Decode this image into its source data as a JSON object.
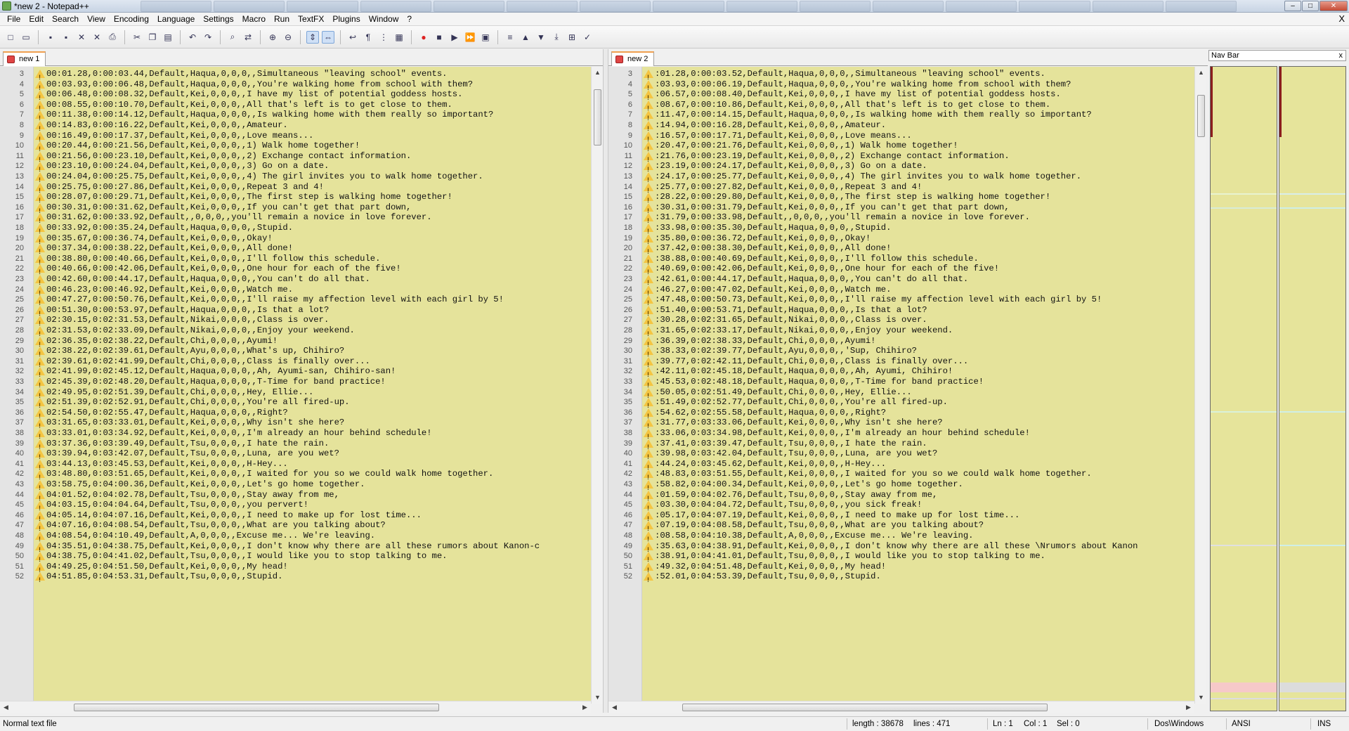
{
  "window": {
    "title": "*new  2 - Notepad++"
  },
  "menu": [
    "File",
    "Edit",
    "Search",
    "View",
    "Encoding",
    "Language",
    "Settings",
    "Macro",
    "Run",
    "TextFX",
    "Plugins",
    "Window",
    "?"
  ],
  "menu_close": "X",
  "toolbar_icons": [
    "new-file-icon",
    "open-icon",
    "save-icon",
    "save-all-icon",
    "close-icon",
    "close-all-icon",
    "print-icon",
    "cut-icon",
    "copy-icon",
    "paste-icon",
    "undo-icon",
    "redo-icon",
    "find-icon",
    "replace-icon",
    "zoom-in-icon",
    "zoom-out-icon",
    "sync-v-icon",
    "sync-h-icon",
    "wrap-icon",
    "all-chars-icon",
    "indent-guide-icon",
    "doc-map-icon",
    "record-icon",
    "stop-icon",
    "play-icon",
    "play-multi-icon",
    "save-macro-icon",
    "compare-icon",
    "prev-diff-icon",
    "next-diff-icon",
    "last-diff-icon",
    "nav-icon",
    "spellcheck-icon"
  ],
  "left": {
    "tab": "new  1",
    "lines": [
      {
        "n": "3",
        "t": "00:01.28,0:00:03.44,Default,Haqua,0,0,0,,Simultaneous \"leaving school\" events."
      },
      {
        "n": "4",
        "t": "00:03.93,0:00:06.48,Default,Haqua,0,0,0,,You're walking home from school with them?"
      },
      {
        "n": "5",
        "t": "00:06.48,0:00:08.32,Default,Kei,0,0,0,,I have my list of potential goddess hosts."
      },
      {
        "n": "6",
        "t": "00:08.55,0:00:10.70,Default,Kei,0,0,0,,All that's left is to get close to them."
      },
      {
        "n": "7",
        "t": "00:11.38,0:00:14.12,Default,Haqua,0,0,0,,Is walking home with them really so important?"
      },
      {
        "n": "8",
        "t": "00:14.83,0:00:16.22,Default,Kei,0,0,0,,Amateur."
      },
      {
        "n": "9",
        "t": "00:16.49,0:00:17.37,Default,Kei,0,0,0,,Love means..."
      },
      {
        "n": "10",
        "t": "00:20.44,0:00:21.56,Default,Kei,0,0,0,,1) Walk home together!"
      },
      {
        "n": "11",
        "t": "00:21.56,0:00:23.10,Default,Kei,0,0,0,,2) Exchange contact information."
      },
      {
        "n": "12",
        "t": "00:23.10,0:00:24.04,Default,Kei,0,0,0,,3) Go on a date."
      },
      {
        "n": "13",
        "t": "00:24.04,0:00:25.75,Default,Kei,0,0,0,,4) The girl invites you to walk home together."
      },
      {
        "n": "14",
        "t": "00:25.75,0:00:27.86,Default,Kei,0,0,0,,Repeat 3 and 4!"
      },
      {
        "n": "15",
        "t": "00:28.07,0:00:29.71,Default,Kei,0,0,0,,The first step is walking home together!"
      },
      {
        "n": "16",
        "t": "00:30.31,0:00:31.62,Default,Kei,0,0,0,,If you can't get that part down,"
      },
      {
        "n": "17",
        "t": "00:31.62,0:00:33.92,Default,,0,0,0,,you'll remain a novice in love forever."
      },
      {
        "n": "18",
        "t": "00:33.92,0:00:35.24,Default,Haqua,0,0,0,,Stupid."
      },
      {
        "n": "19",
        "t": "00:35.67,0:00:36.74,Default,Kei,0,0,0,,Okay!"
      },
      {
        "n": "20",
        "t": "00:37.34,0:00:38.22,Default,Kei,0,0,0,,All done!"
      },
      {
        "n": "21",
        "t": "00:38.80,0:00:40.66,Default,Kei,0,0,0,,I'll follow this schedule."
      },
      {
        "n": "22",
        "t": "00:40.66,0:00:42.06,Default,Kei,0,0,0,,One hour for each of the five!"
      },
      {
        "n": "23",
        "t": "00:42.60,0:00:44.17,Default,Haqua,0,0,0,,You can't do all that."
      },
      {
        "n": "24",
        "t": "00:46.23,0:00:46.92,Default,Kei,0,0,0,,Watch me."
      },
      {
        "n": "25",
        "t": "00:47.27,0:00:50.76,Default,Kei,0,0,0,,I'll raise my affection level with each girl by 5!"
      },
      {
        "n": "26",
        "t": "00:51.30,0:00:53.97,Default,Haqua,0,0,0,,Is that a lot?"
      },
      {
        "n": "27",
        "t": "02:30.15,0:02:31.53,Default,Nikai,0,0,0,,Class is over."
      },
      {
        "n": "28",
        "t": "02:31.53,0:02:33.09,Default,Nikai,0,0,0,,Enjoy your weekend."
      },
      {
        "n": "29",
        "t": "02:36.35,0:02:38.22,Default,Chi,0,0,0,,Ayumi!"
      },
      {
        "n": "30",
        "t": "02:38.22,0:02:39.61,Default,Ayu,0,0,0,,What's up, Chihiro?"
      },
      {
        "n": "31",
        "t": "02:39.61,0:02:41.99,Default,Chi,0,0,0,,Class is finally over..."
      },
      {
        "n": "32",
        "t": "02:41.99,0:02:45.12,Default,Haqua,0,0,0,,Ah, Ayumi-san, Chihiro-san!"
      },
      {
        "n": "33",
        "t": "02:45.39,0:02:48.20,Default,Haqua,0,0,0,,T-Time for band practice!"
      },
      {
        "n": "34",
        "t": "02:49.95,0:02:51.39,Default,Chi,0,0,0,,Hey, Ellie..."
      },
      {
        "n": "35",
        "t": "02:51.39,0:02:52.91,Default,Chi,0,0,0,,You're all fired-up."
      },
      {
        "n": "36",
        "t": "02:54.50,0:02:55.47,Default,Haqua,0,0,0,,Right?"
      },
      {
        "n": "37",
        "t": "03:31.65,0:03:33.01,Default,Kei,0,0,0,,Why isn't she here?"
      },
      {
        "n": "38",
        "t": "03:33.01,0:03:34.92,Default,Kei,0,0,0,,I'm already an hour behind schedule!"
      },
      {
        "n": "39",
        "t": "03:37.36,0:03:39.49,Default,Tsu,0,0,0,,I hate the rain."
      },
      {
        "n": "40",
        "t": "03:39.94,0:03:42.07,Default,Tsu,0,0,0,,Luna, are you wet?"
      },
      {
        "n": "41",
        "t": "03:44.13,0:03:45.53,Default,Kei,0,0,0,,H-Hey..."
      },
      {
        "n": "42",
        "t": "03:48.80,0:03:51.65,Default,Kei,0,0,0,,I waited for you so we could walk home together."
      },
      {
        "n": "43",
        "t": "03:58.75,0:04:00.36,Default,Kei,0,0,0,,Let's go home together."
      },
      {
        "n": "44",
        "t": "04:01.52,0:04:02.78,Default,Tsu,0,0,0,,Stay away from me,"
      },
      {
        "n": "45",
        "t": "04:03.15,0:04:04.64,Default,Tsu,0,0,0,,you pervert!"
      },
      {
        "n": "46",
        "t": "04:05.14,0:04:07.16,Default,Kei,0,0,0,,I need to make up for lost time..."
      },
      {
        "n": "47",
        "t": "04:07.16,0:04:08.54,Default,Tsu,0,0,0,,What are you talking about?"
      },
      {
        "n": "48",
        "t": "04:08.54,0:04:10.49,Default,A,0,0,0,,Excuse me... We're leaving."
      },
      {
        "n": "49",
        "t": "04:35.51,0:04:38.75,Default,Kei,0,0,0,,I don't know why there are all these rumors about Kanon-c"
      },
      {
        "n": "50",
        "t": "04:38.75,0:04:41.02,Default,Tsu,0,0,0,,I would like you to stop talking to me."
      },
      {
        "n": "51",
        "t": "04:49.25,0:04:51.50,Default,Kei,0,0,0,,My head!"
      },
      {
        "n": "52",
        "t": "04:51.85,0:04:53.31,Default,Tsu,0,0,0,,Stupid."
      }
    ]
  },
  "right": {
    "tab": "new  2",
    "lines": [
      {
        "n": "3",
        "t": ":01.28,0:00:03.52,Default,Haqua,0,0,0,,Simultaneous \"leaving school\" events."
      },
      {
        "n": "4",
        "t": ":03.93,0:00:06.19,Default,Haqua,0,0,0,,You're walking home from school with them?"
      },
      {
        "n": "5",
        "t": ":06.57,0:00:08.40,Default,Kei,0,0,0,,I have my list of potential goddess hosts."
      },
      {
        "n": "6",
        "t": ":08.67,0:00:10.86,Default,Kei,0,0,0,,All that's left is to get close to them."
      },
      {
        "n": "7",
        "t": ":11.47,0:00:14.15,Default,Haqua,0,0,0,,Is walking home with them really so important?"
      },
      {
        "n": "8",
        "t": ":14.94,0:00:16.28,Default,Kei,0,0,0,,Amateur."
      },
      {
        "n": "9",
        "t": ":16.57,0:00:17.71,Default,Kei,0,0,0,,Love means..."
      },
      {
        "n": "10",
        "t": ":20.47,0:00:21.76,Default,Kei,0,0,0,,1) Walk home together!"
      },
      {
        "n": "11",
        "t": ":21.76,0:00:23.19,Default,Kei,0,0,0,,2) Exchange contact information."
      },
      {
        "n": "12",
        "t": ":23.19,0:00:24.17,Default,Kei,0,0,0,,3) Go on a date."
      },
      {
        "n": "13",
        "t": ":24.17,0:00:25.77,Default,Kei,0,0,0,,4) The girl invites you to walk home together."
      },
      {
        "n": "14",
        "t": ":25.77,0:00:27.82,Default,Kei,0,0,0,,Repeat 3 and 4!"
      },
      {
        "n": "15",
        "t": ":28.22,0:00:29.80,Default,Kei,0,0,0,,The first step is walking home together!"
      },
      {
        "n": "16",
        "t": ":30.31,0:00:31.79,Default,Kei,0,0,0,,If you can't get that part down,"
      },
      {
        "n": "17",
        "t": ":31.79,0:00:33.98,Default,,0,0,0,,you'll remain a novice in love forever."
      },
      {
        "n": "18",
        "t": ":33.98,0:00:35.30,Default,Haqua,0,0,0,,Stupid."
      },
      {
        "n": "19",
        "t": ":35.80,0:00:36.72,Default,Kei,0,0,0,,Okay!"
      },
      {
        "n": "20",
        "t": ":37.42,0:00:38.30,Default,Kei,0,0,0,,All done!"
      },
      {
        "n": "21",
        "t": ":38.88,0:00:40.69,Default,Kei,0,0,0,,I'll follow this schedule."
      },
      {
        "n": "22",
        "t": ":40.69,0:00:42.06,Default,Kei,0,0,0,,One hour for each of the five!"
      },
      {
        "n": "23",
        "t": ":42.61,0:00:44.17,Default,Haqua,0,0,0,,You can't do all that."
      },
      {
        "n": "24",
        "t": ":46.27,0:00:47.02,Default,Kei,0,0,0,,Watch me."
      },
      {
        "n": "25",
        "t": ":47.48,0:00:50.73,Default,Kei,0,0,0,,I'll raise my affection level with each girl by 5!"
      },
      {
        "n": "26",
        "t": ":51.40,0:00:53.71,Default,Haqua,0,0,0,,Is that a lot?"
      },
      {
        "n": "27",
        "t": ":30.28,0:02:31.65,Default,Nikai,0,0,0,,Class is over."
      },
      {
        "n": "28",
        "t": ":31.65,0:02:33.17,Default,Nikai,0,0,0,,Enjoy your weekend."
      },
      {
        "n": "29",
        "t": ":36.39,0:02:38.33,Default,Chi,0,0,0,,Ayumi!"
      },
      {
        "n": "30",
        "t": ":38.33,0:02:39.77,Default,Ayu,0,0,0,,'Sup, Chihiro?"
      },
      {
        "n": "31",
        "t": ":39.77,0:02:42.11,Default,Chi,0,0,0,,Class is finally over..."
      },
      {
        "n": "32",
        "t": ":42.11,0:02:45.18,Default,Haqua,0,0,0,,Ah, Ayumi, Chihiro!"
      },
      {
        "n": "33",
        "t": ":45.53,0:02:48.18,Default,Haqua,0,0,0,,T-Time for band practice!"
      },
      {
        "n": "34",
        "t": ":50.05,0:02:51.49,Default,Chi,0,0,0,,Hey, Ellie..."
      },
      {
        "n": "35",
        "t": ":51.49,0:02:52.77,Default,Chi,0,0,0,,You're all fired-up."
      },
      {
        "n": "36",
        "t": ":54.62,0:02:55.58,Default,Haqua,0,0,0,,Right?"
      },
      {
        "n": "37",
        "t": ":31.77,0:03:33.06,Default,Kei,0,0,0,,Why isn't she here?"
      },
      {
        "n": "38",
        "t": ":33.06,0:03:34.98,Default,Kei,0,0,0,,I'm already an hour behind schedule!"
      },
      {
        "n": "39",
        "t": ":37.41,0:03:39.47,Default,Tsu,0,0,0,,I hate the rain."
      },
      {
        "n": "40",
        "t": ":39.98,0:03:42.04,Default,Tsu,0,0,0,,Luna, are you wet?"
      },
      {
        "n": "41",
        "t": ":44.24,0:03:45.62,Default,Kei,0,0,0,,H-Hey..."
      },
      {
        "n": "42",
        "t": ":48.83,0:03:51.55,Default,Kei,0,0,0,,I waited for you so we could walk home together."
      },
      {
        "n": "43",
        "t": ":58.82,0:04:00.34,Default,Kei,0,0,0,,Let's go home together."
      },
      {
        "n": "44",
        "t": ":01.59,0:04:02.76,Default,Tsu,0,0,0,,Stay away from me,"
      },
      {
        "n": "45",
        "t": ":03.30,0:04:04.72,Default,Tsu,0,0,0,,you sick freak!"
      },
      {
        "n": "46",
        "t": ":05.17,0:04:07.19,Default,Kei,0,0,0,,I need to make up for lost time..."
      },
      {
        "n": "47",
        "t": ":07.19,0:04:08.58,Default,Tsu,0,0,0,,What are you talking about?"
      },
      {
        "n": "48",
        "t": ":08.58,0:04:10.38,Default,A,0,0,0,,Excuse me... We're leaving."
      },
      {
        "n": "49",
        "t": ":35.63,0:04:38.91,Default,Kei,0,0,0,,I don't know why there are all these \\Nrumors about Kanon"
      },
      {
        "n": "50",
        "t": ":38.91,0:04:41.01,Default,Tsu,0,0,0,,I would like you to stop talking to me."
      },
      {
        "n": "51",
        "t": ":49.32,0:04:51.48,Default,Kei,0,0,0,,My head!"
      },
      {
        "n": "52",
        "t": ":52.01,0:04:53.39,Default,Tsu,0,0,0,,Stupid."
      }
    ]
  },
  "navbar": {
    "title": "Nav Bar",
    "close": "x"
  },
  "status": {
    "file_type": "Normal text file",
    "length": "length : 38678",
    "lines": "lines : 471",
    "ln": "Ln : 1",
    "col": "Col : 1",
    "sel": "Sel : 0",
    "eol": "Dos\\Windows",
    "encoding": "ANSI",
    "mode": "INS"
  },
  "colors": {
    "editor_bg": "#e5e39b",
    "warn": "#f4c542",
    "tab_accent": "#f0a050"
  }
}
